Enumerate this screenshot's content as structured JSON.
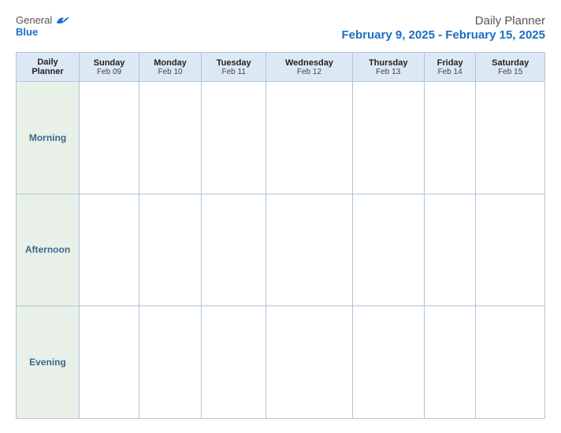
{
  "header": {
    "logo_general": "General",
    "logo_blue": "Blue",
    "title_line1": "Daily Planner",
    "title_line2": "February 9, 2025 - February 15, 2025"
  },
  "table": {
    "corner_label_line1": "Daily",
    "corner_label_line2": "Planner",
    "columns": [
      {
        "day": "Sunday",
        "date": "Feb 09"
      },
      {
        "day": "Monday",
        "date": "Feb 10"
      },
      {
        "day": "Tuesday",
        "date": "Feb 11"
      },
      {
        "day": "Wednesday",
        "date": "Feb 12"
      },
      {
        "day": "Thursday",
        "date": "Feb 13"
      },
      {
        "day": "Friday",
        "date": "Feb 14"
      },
      {
        "day": "Saturday",
        "date": "Feb 15"
      }
    ],
    "rows": [
      {
        "label": "Morning"
      },
      {
        "label": "Afternoon"
      },
      {
        "label": "Evening"
      }
    ]
  }
}
